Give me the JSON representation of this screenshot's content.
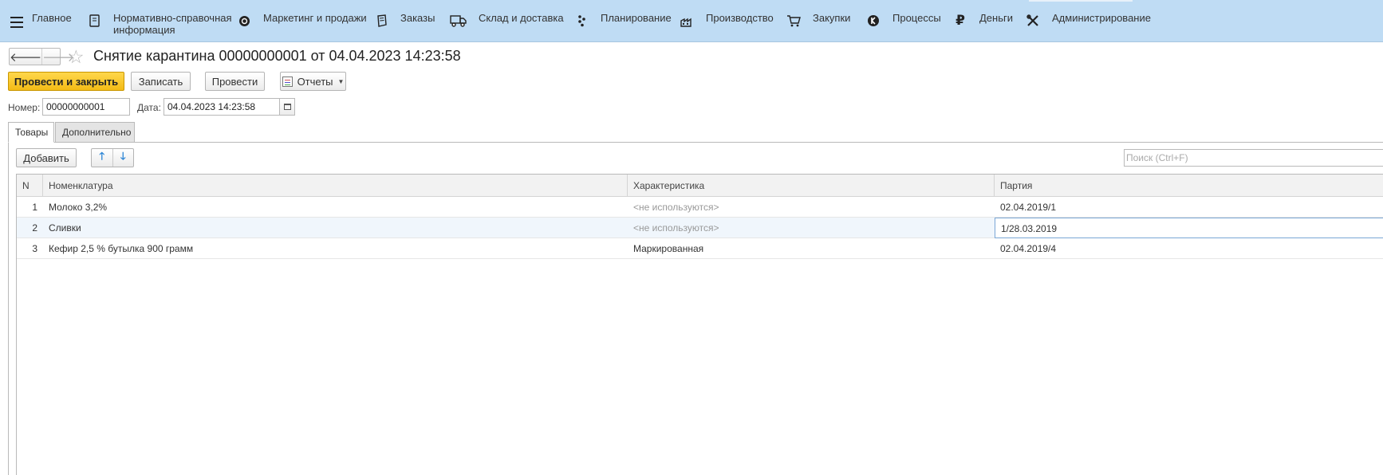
{
  "sections": [
    {
      "label": "Главное",
      "icon": "main-icon"
    },
    {
      "label": "Нормативно-справочная\nинформация",
      "icon": "reference-book-icon"
    },
    {
      "label": "Маркетинг и продажи",
      "icon": "marketing-icon"
    },
    {
      "label": "Заказы",
      "icon": "orders-icon"
    },
    {
      "label": "Склад и доставка",
      "icon": "truck-icon"
    },
    {
      "label": "Планирование",
      "icon": "planning-icon"
    },
    {
      "label": "Производство",
      "icon": "factory-icon"
    },
    {
      "label": "Закупки",
      "icon": "cart-icon"
    },
    {
      "label": "Процессы",
      "icon": "processes-icon"
    },
    {
      "label": "Деньги",
      "icon": "ruble-icon"
    },
    {
      "label": "Администрирование",
      "icon": "tools-icon"
    }
  ],
  "document": {
    "title": "Снятие карантина 00000000001 от 04.04.2023 14:23:58"
  },
  "toolbar": {
    "post_close": "Провести и закрыть",
    "save": "Записать",
    "post": "Провести",
    "reports": "Отчеты"
  },
  "header": {
    "number_label": "Номер:",
    "number_value": "00000000001",
    "date_label": "Дата:",
    "date_value": "04.04.2023 14:23:58"
  },
  "tabs": [
    {
      "label": "Товары",
      "active": true
    },
    {
      "label": "Дополнительно",
      "active": false
    }
  ],
  "table_toolbar": {
    "add": "Добавить",
    "search_placeholder": "Поиск (Ctrl+F)"
  },
  "table": {
    "columns": [
      "N",
      "Номенклатура",
      "Характеристика",
      "Партия"
    ],
    "rows": [
      {
        "n": "1",
        "nomenclature": "Молоко 3,2%",
        "characteristic": "<не используются>",
        "batch": "02.04.2019/1"
      },
      {
        "n": "2",
        "nomenclature": "Сливки",
        "characteristic": "<не используются>",
        "batch": "1/28.03.2019"
      },
      {
        "n": "3",
        "nomenclature": "Кефир 2,5 % бутылка 900 грамм",
        "characteristic": "Маркированная",
        "batch": "02.04.2019/4"
      }
    ]
  },
  "colors": {
    "section_bar": "#bfdcf4",
    "primary_button": "#f3bb16",
    "arrow_blue": "#2e86d6"
  }
}
